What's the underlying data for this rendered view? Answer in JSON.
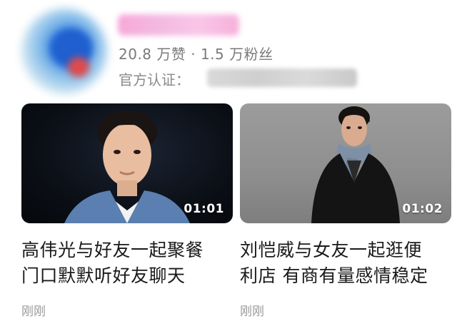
{
  "profile": {
    "stats": "20.8 万赞 · 1.5 万粉丝",
    "verify_label": "官方认证："
  },
  "videos": [
    {
      "duration": "01:01",
      "title_line1": "高伟光与好友一起聚餐",
      "title_line2": "门口默默听好友聊天",
      "time": "刚刚"
    },
    {
      "duration": "01:02",
      "title_line1": "刘恺威与女友一起逛便",
      "title_line2": "利店 有商有量感情稳定",
      "time": "刚刚"
    }
  ],
  "colors": {
    "stats_text": "#7a7a7a",
    "title_text": "#1a1a1a",
    "time_text": "#9a9a9a",
    "name_blur": "#f5b0da"
  }
}
